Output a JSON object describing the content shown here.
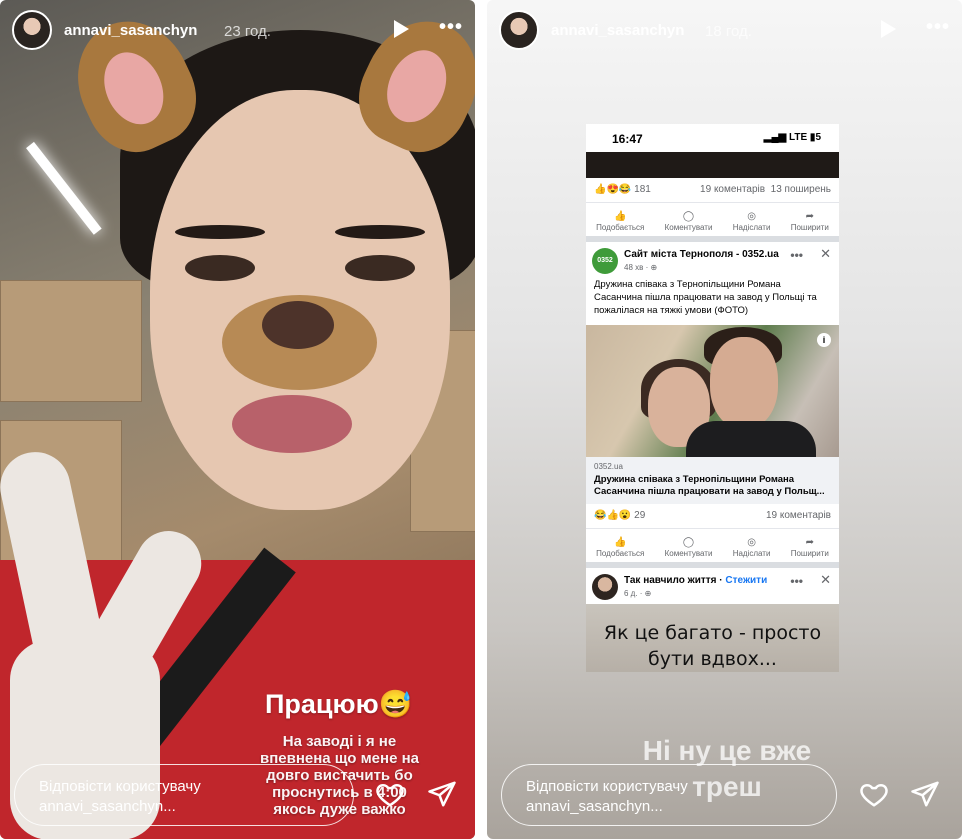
{
  "stories": [
    {
      "username": "annavi_sasanchyn",
      "time": "23 год.",
      "caption_title": "Працюю😅",
      "caption_text": "На заводі і я не впевнена що мене на довго вистачить бо проснутись в 4:00 якось дуже важко",
      "reply_placeholder": "Відповісти користувачу annavi_sasanchyn..."
    },
    {
      "username": "annavi_sasanchyn",
      "time": "18 год.",
      "caption": "Ні ну це вже треш",
      "reply_placeholder": "Відповісти користувачу annavi_sasanchyn...",
      "screenshot": {
        "clock": "16:47",
        "signal": "LTE",
        "battery": "5",
        "post1": {
          "reactions": "181",
          "comments": "19 коментарів",
          "shares": "13 поширень"
        },
        "actions": [
          "Подобається",
          "Коментувати",
          "Надіслати",
          "Поширити"
        ],
        "post2": {
          "page_logo": "0352",
          "page_name": "Сайт міста Тернополя - 0352.ua",
          "meta": "48 хв · ⊕",
          "text": "Дружина співака з Тернопільщини Романа Сасанчина пішла працювати на завод у Польщі та пожалілася на тяжкі умови (ФОТО)",
          "info": "i",
          "link_domain": "0352.ua",
          "link_title_1": "Дружина співака з Тернопільщини Романа",
          "link_title_2": "Сасанчина пішла працювати на завод у Польщ...",
          "reactions": "29",
          "comments": "19 коментарів"
        },
        "post3": {
          "name": "Так навчило життя",
          "follow": "Стежити",
          "meta": "6 д. · ⊕",
          "quote_1": "Як це багато - просто",
          "quote_2": "бути вдвох..."
        }
      }
    }
  ],
  "icons": {
    "play": "play-icon",
    "more": "more-icon",
    "heart": "heart-icon",
    "send": "send-icon",
    "dots": "•••",
    "close": "✕"
  }
}
